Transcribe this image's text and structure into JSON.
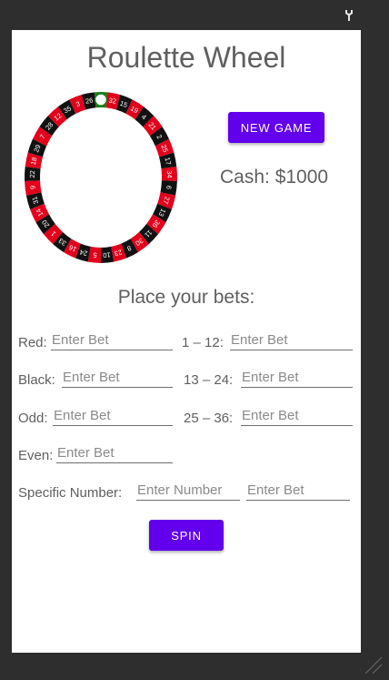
{
  "app": {
    "title": "Roulette Wheel",
    "new_game_label": "NEW GAME",
    "cash_label": "Cash: ",
    "cash_value": "$1000",
    "place_bets_label": "Place your bets:",
    "spin_label": "SPIN",
    "accent_color": "#6200ee"
  },
  "wheel": {
    "numbers": [
      "0",
      "32",
      "15",
      "19",
      "4",
      "21",
      "2",
      "25",
      "17",
      "34",
      "6",
      "27",
      "13",
      "36",
      "11",
      "30",
      "8",
      "23",
      "10",
      "5",
      "24",
      "16",
      "33",
      "1",
      "20",
      "14",
      "31",
      "9",
      "22",
      "18",
      "29",
      "7",
      "28",
      "12",
      "35",
      "3",
      "26"
    ],
    "colors": {
      "red": "#e3001b",
      "black": "#111111",
      "green": "#1a7f1a"
    },
    "ball_on": "0"
  },
  "bets": {
    "red": {
      "label": "Red:",
      "placeholder": "Enter Bet"
    },
    "black": {
      "label": "Black:",
      "placeholder": "Enter Bet"
    },
    "odd": {
      "label": "Odd:",
      "placeholder": "Enter Bet"
    },
    "even": {
      "label": "Even:",
      "placeholder": "Enter Bet"
    },
    "range1": {
      "label": "1 – 12:",
      "placeholder": "Enter Bet"
    },
    "range2": {
      "label": "13 – 24:",
      "placeholder": "Enter Bet"
    },
    "range3": {
      "label": "25 – 36:",
      "placeholder": "Enter Bet"
    },
    "specific": {
      "label": "Specific Number:",
      "number_placeholder": "Enter Number",
      "bet_placeholder": "Enter Bet"
    }
  },
  "icons": {
    "top_right": "wrench-icon",
    "bottom_right": "resize-grip-icon"
  }
}
